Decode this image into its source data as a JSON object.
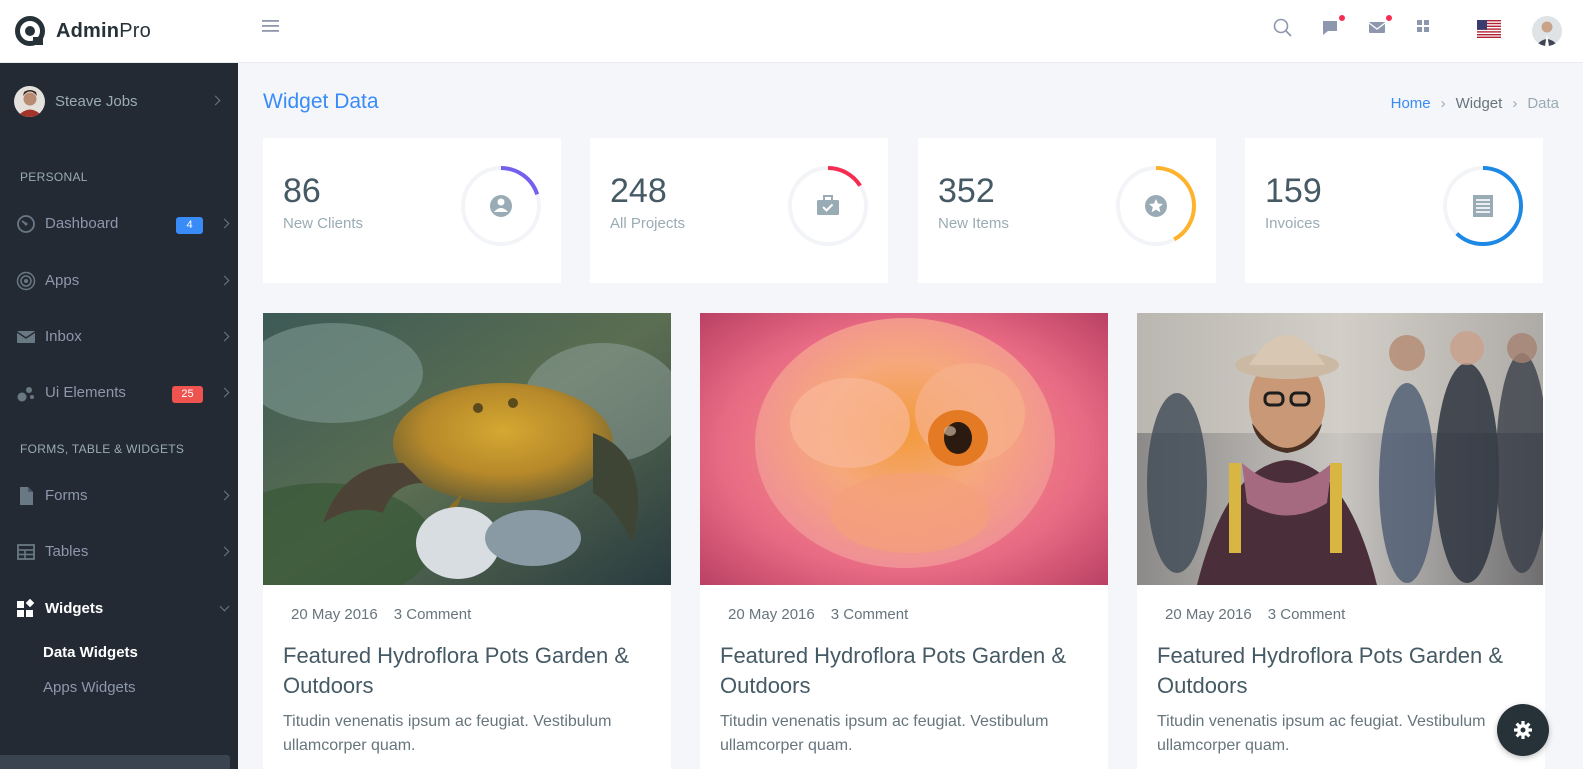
{
  "brand": {
    "bold": "Admin",
    "light": "Pro"
  },
  "icons": {
    "menu": "hamburger-icon",
    "search": "search-icon",
    "chat": "chat-icon",
    "mail": "mail-icon",
    "apps": "grid-icon",
    "flag": "us-flag-icon",
    "settings": "gear-icon"
  },
  "colors": {
    "accent": "#398bf7",
    "sidebar": "#242a33",
    "danger": "#f62d51"
  },
  "sidebar": {
    "user_name": "Steave Jobs",
    "section_personal": "PERSONAL",
    "section_forms": "FORMS, TABLE & WIDGETS",
    "items": [
      {
        "label": "Dashboard",
        "badge": "4",
        "badge_color": "#398bf7",
        "icon": "gauge-icon"
      },
      {
        "label": "Apps",
        "icon": "target-icon"
      },
      {
        "label": "Inbox",
        "icon": "envelope-icon"
      },
      {
        "label": "Ui Elements",
        "badge": "25",
        "badge_color": "#ef5350",
        "icon": "bubbles-icon"
      },
      {
        "label": "Forms",
        "icon": "document-icon"
      },
      {
        "label": "Tables",
        "icon": "table-icon"
      },
      {
        "label": "Widgets",
        "icon": "widgets-icon",
        "active": true
      }
    ],
    "sub_items": [
      {
        "label": "Data Widgets",
        "active": true
      },
      {
        "label": "Apps Widgets"
      }
    ]
  },
  "page": {
    "title": "Widget Data",
    "breadcrumb": [
      "Home",
      "Widget",
      "Data"
    ]
  },
  "stats": [
    {
      "value": "86",
      "label": "New Clients",
      "icon": "user-circle-icon",
      "color": "#7460ee",
      "progress": 0.2
    },
    {
      "value": "248",
      "label": "All Projects",
      "icon": "briefcase-icon",
      "color": "#f62d51",
      "progress": 0.16
    },
    {
      "value": "352",
      "label": "New Items",
      "icon": "star-circle-icon",
      "color": "#ffb22b",
      "progress": 0.42
    },
    {
      "value": "159",
      "label": "Invoices",
      "icon": "invoice-icon",
      "color": "#1e88e5",
      "progress": 0.62
    }
  ],
  "cards": [
    {
      "date": "20 May 2016",
      "comments": "3 Comment",
      "title": "Featured Hydroflora Pots Garden & Outdoors",
      "text": "Titudin venenatis ipsum ac feugiat. Vestibulum ullamcorper quam.",
      "image": "crab-photo"
    },
    {
      "date": "20 May 2016",
      "comments": "3 Comment",
      "title": "Featured Hydroflora Pots Garden & Outdoors",
      "text": "Titudin venenatis ipsum ac feugiat. Vestibulum ullamcorper quam.",
      "image": "flower-photo"
    },
    {
      "date": "20 May 2016",
      "comments": "3 Comment",
      "title": "Featured Hydroflora Pots Garden & Outdoors",
      "text": "Titudin venenatis ipsum ac feugiat. Vestibulum ullamcorper quam.",
      "image": "man-photo"
    }
  ]
}
